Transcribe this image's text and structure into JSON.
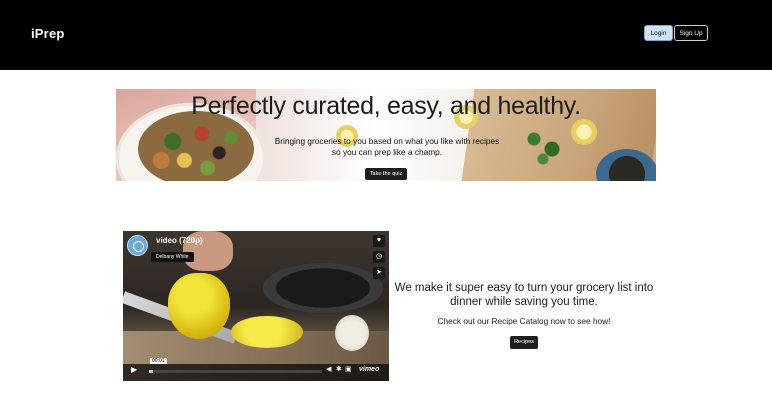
{
  "header": {
    "brand": "iPrep",
    "login_label": "Login",
    "signup_label": "Sign Up"
  },
  "hero": {
    "title": "Perfectly curated, easy, and healthy.",
    "subtitle": "Bringing groceries to you based on what you like with recipes so you can prep like a champ.",
    "button_label": "Take the quiz"
  },
  "video": {
    "title": "video (720p)",
    "byline": "Delbany White",
    "timecode": "00:01",
    "brand": "vimeo",
    "side_icons": [
      "heart-icon",
      "clock-icon",
      "share-icon"
    ],
    "control_icons": [
      "play-icon",
      "volume-icon",
      "settings-icon",
      "pip-icon",
      "fullscreen-icon"
    ]
  },
  "promo": {
    "headline": "We make it super easy to turn your grocery list into dinner while saving you time.",
    "subtext": "Check out our Recipe Catalog now to see how!",
    "button_label": "Recipes"
  }
}
